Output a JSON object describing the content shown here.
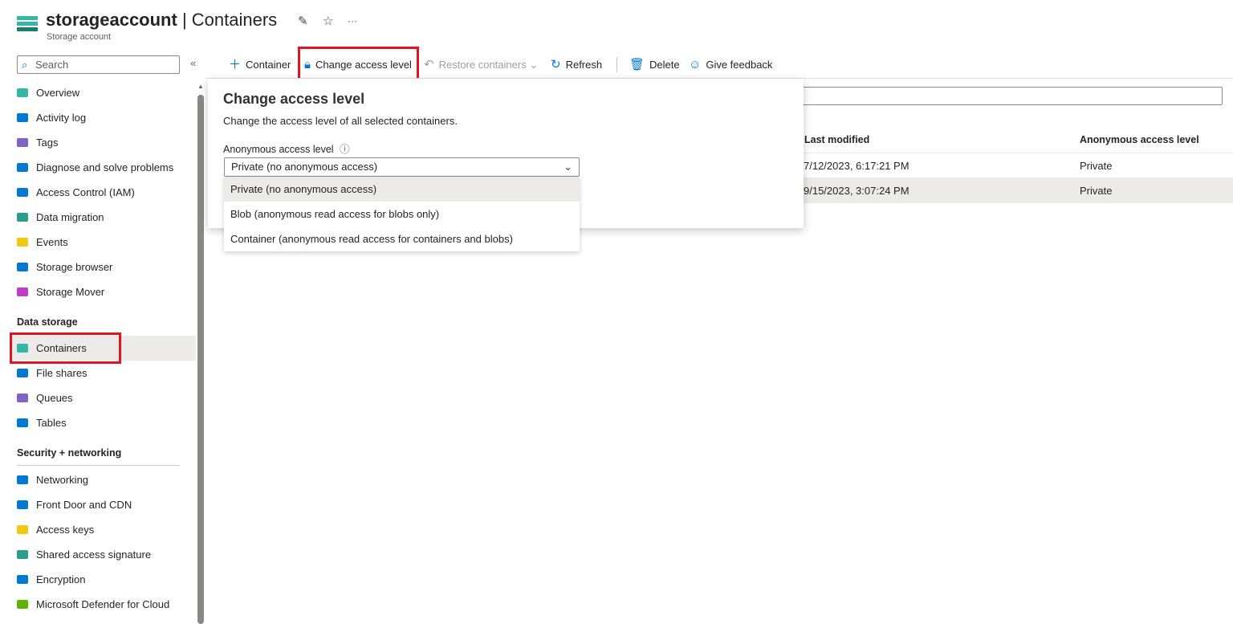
{
  "header": {
    "resource_name": "storageaccount",
    "separator": " | ",
    "page": "Containers",
    "subtitle": "Storage account",
    "pin_icon": "pin-icon",
    "favorite_icon": "star-icon",
    "more": "···"
  },
  "sidebar": {
    "search_placeholder": "Search",
    "collapse": "«",
    "items": [
      {
        "label": "Overview",
        "color": "#36b6a8"
      },
      {
        "label": "Activity log",
        "color": "#0078d4"
      },
      {
        "label": "Tags",
        "color": "#8661c5"
      },
      {
        "label": "Diagnose and solve problems",
        "color": "#0078d4"
      },
      {
        "label": "Access Control (IAM)",
        "color": "#0078d4"
      },
      {
        "label": "Data migration",
        "color": "#2a9d8f"
      },
      {
        "label": "Events",
        "color": "#f2c811"
      },
      {
        "label": "Storage browser",
        "color": "#0078d4"
      },
      {
        "label": "Storage Mover",
        "color": "#c03bc4"
      }
    ],
    "data_storage_heading": "Data storage",
    "data_storage": [
      {
        "label": "Containers",
        "color": "#36b6a8"
      },
      {
        "label": "File shares",
        "color": "#0078d4"
      },
      {
        "label": "Queues",
        "color": "#8661c5"
      },
      {
        "label": "Tables",
        "color": "#0078d4"
      }
    ],
    "security_heading": "Security + networking",
    "security": [
      {
        "label": "Networking",
        "color": "#0078d4"
      },
      {
        "label": "Front Door and CDN",
        "color": "#0078d4"
      },
      {
        "label": "Access keys",
        "color": "#f2c811"
      },
      {
        "label": "Shared access signature",
        "color": "#2a9d8f"
      },
      {
        "label": "Encryption",
        "color": "#0078d4"
      },
      {
        "label": "Microsoft Defender for Cloud",
        "color": "#5db300"
      }
    ]
  },
  "toolbar": {
    "container": "Container",
    "change_access": "Change access level",
    "restore": "Restore containers",
    "refresh": "Refresh",
    "delete": "Delete",
    "feedback": "Give feedback"
  },
  "table": {
    "headers": {
      "last_modified": "Last modified",
      "access": "Anonymous access level"
    },
    "rows": [
      {
        "last_modified": "7/12/2023, 6:17:21 PM",
        "access": "Private"
      },
      {
        "last_modified": "9/15/2023, 3:07:24 PM",
        "access": "Private"
      }
    ]
  },
  "panel": {
    "title": "Change access level",
    "description": "Change the access level of all selected containers.",
    "field_label": "Anonymous access level",
    "info_icon": "ⓘ",
    "selected": "Private (no anonymous access)",
    "options": [
      "Private (no anonymous access)",
      "Blob (anonymous read access for blobs only)",
      "Container (anonymous read access for containers and blobs)"
    ]
  },
  "highlight_color": "#e3141f"
}
